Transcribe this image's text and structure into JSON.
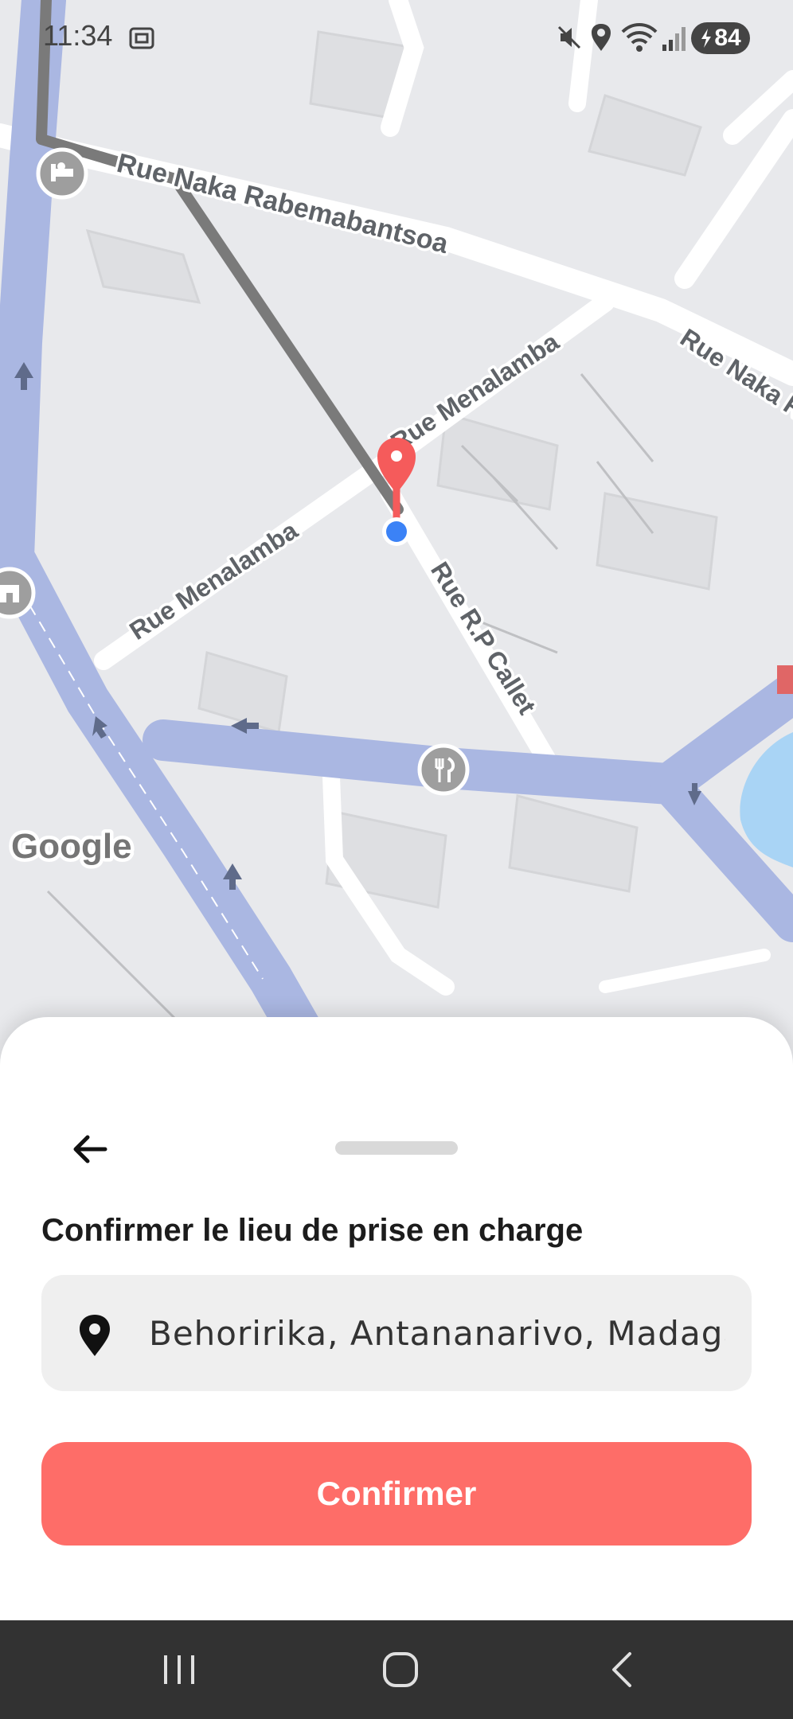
{
  "status_bar": {
    "time": "11:34",
    "battery": "84",
    "icons": [
      "screenshot-icon",
      "mute-icon",
      "location-icon",
      "wifi-icon",
      "signal-icon",
      "battery-charging-icon"
    ]
  },
  "map": {
    "streets": {
      "rabemabantsoa": "Rue Naka Rabemabantsoa",
      "menalamba_upper": "Rue Menalamba",
      "menalamba_lower": "Rue Menalamba",
      "callet": "Rue R.P Callet",
      "naka_right": "Rue Naka R"
    },
    "attribution": "Google",
    "poi_icons": [
      "hotel-icon",
      "landmark-icon",
      "restaurant-icon"
    ],
    "colors": {
      "pin": "#f55b5b",
      "current_location": "#3b82f6",
      "route": "#7a7a7a",
      "main_road": "#aab7e2",
      "water": "#a9d4f5"
    }
  },
  "sheet": {
    "title": "Confirmer le lieu de prise en charge",
    "address_value": "Behoririka, Antananarivo, Madagascar",
    "confirm_label": "Confirmer",
    "colors": {
      "accent": "#fe6d68",
      "field_bg": "#efefef"
    }
  },
  "nav_bar": {
    "buttons": [
      "recents-icon",
      "home-icon",
      "back-icon"
    ]
  }
}
